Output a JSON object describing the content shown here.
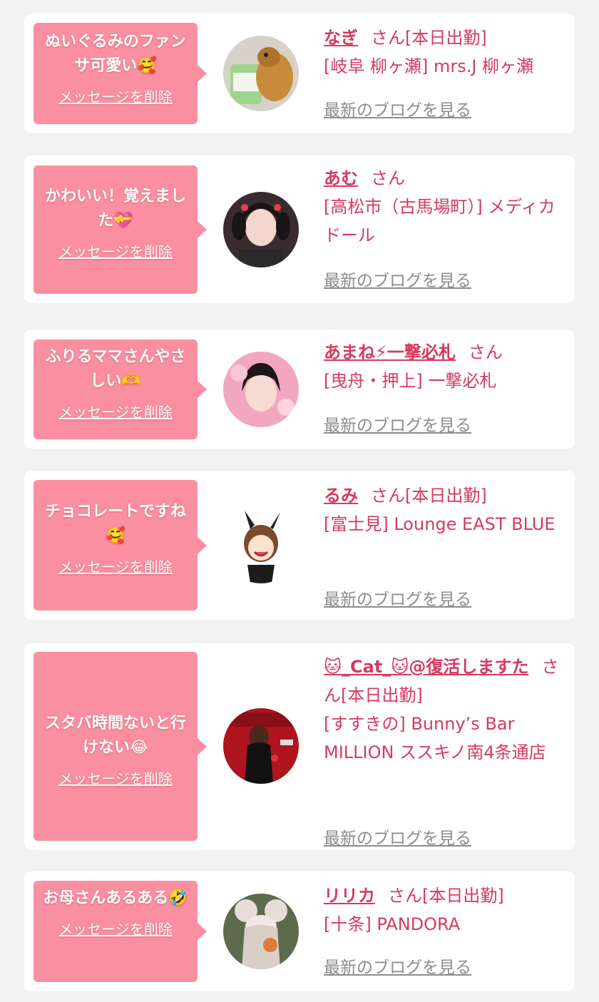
{
  "san_suffix": "さん",
  "delete_label": "メッセージを削除",
  "blog_label": "最新のブログを見る",
  "colors": {
    "accent": "#d63a60",
    "bubble": "#f98fa0",
    "card": "#ffffff",
    "page": "#f2f2f2",
    "link_gray": "#8c8c8c"
  },
  "messages": [
    {
      "message": "ぬいぐるみのファンサ可愛い🥰",
      "name": "なぎ",
      "status": "[本日出勤]",
      "shop": "[岐阜 柳ヶ瀬] mrs.J 柳ヶ瀬",
      "avatar_icon": "dog-plush-photo"
    },
    {
      "message": "かわいい！覚えました💝",
      "name": "あむ",
      "status": "",
      "shop": "[高松市（古馬場町）] メディカドール",
      "avatar_icon": "girl-pigtails-photo"
    },
    {
      "message": "ふりるママさんやさしい🫶",
      "name": "あまね⚡一撃必札",
      "status": "",
      "shop": "[曳舟・押上] 一撃必札",
      "avatar_icon": "girl-pink-photo"
    },
    {
      "message": "チョコレートですね🥰",
      "name": "るみ",
      "status": "[本日出勤]",
      "shop": "[富士見] Lounge EAST BLUE",
      "avatar_icon": "bunny-girl-illustration"
    },
    {
      "message": "スタバ時間ないと行けない😂",
      "name": "🐱_Cat_🐱@復活しますた",
      "status": "[本日出勤]",
      "shop": "[すすきの] Bunny’s Bar MILLION ススキノ南4条通店",
      "avatar_icon": "red-bar-photo"
    },
    {
      "message": "お母さんあるある🤣",
      "name": "リリカ",
      "status": "[本日出勤]",
      "shop": "[十条] PANDORA",
      "avatar_icon": "mouse-ears-photo"
    }
  ]
}
